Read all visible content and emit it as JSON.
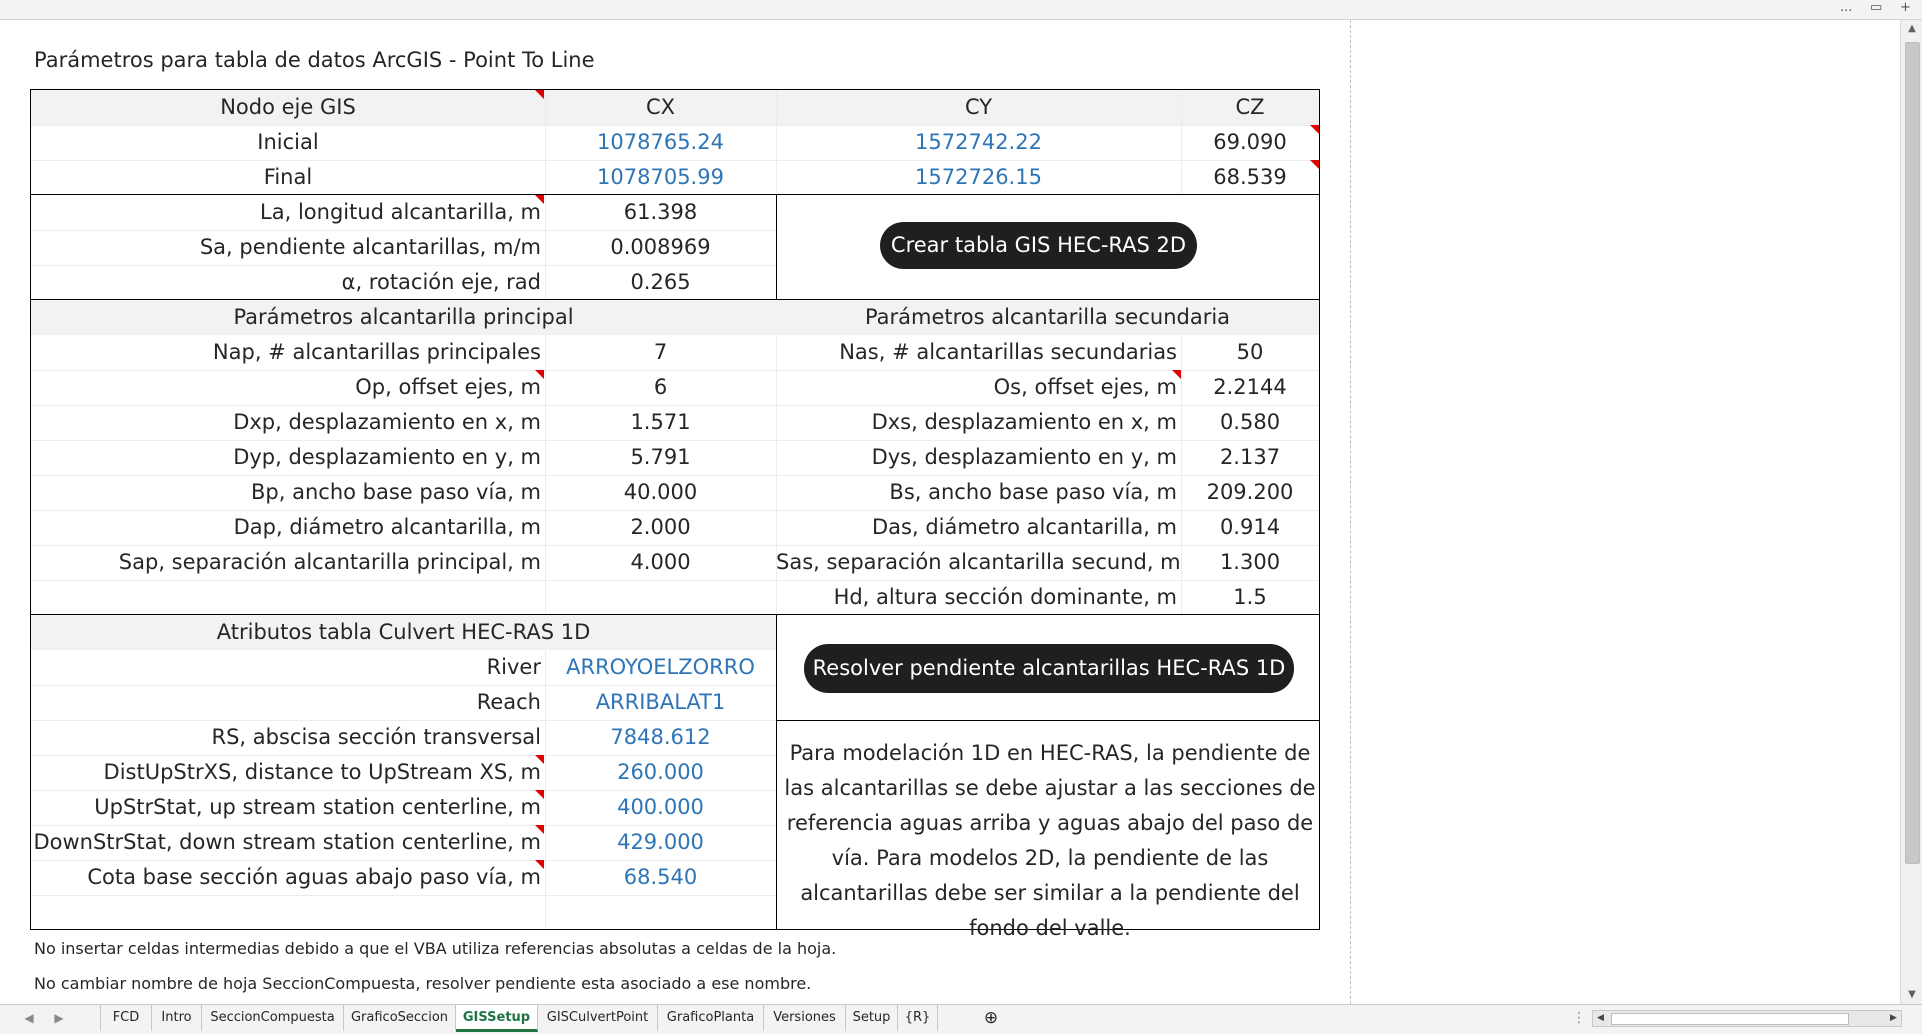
{
  "window": {
    "controls": [
      "...",
      "▭",
      "+"
    ]
  },
  "title": "Parámetros para tabla de datos ArcGIS - Point To Line",
  "nodes": {
    "headers": [
      "Nodo eje GIS",
      "CX",
      "CY",
      "CZ"
    ],
    "rows": [
      {
        "name": "Inicial",
        "cx": "1078765.24",
        "cy": "1572742.22",
        "cz": "69.090"
      },
      {
        "name": "Final",
        "cx": "1078705.99",
        "cy": "1572726.15",
        "cz": "68.539"
      }
    ]
  },
  "geometry": [
    {
      "label": "La, longitud alcantarilla, m",
      "value": "61.398"
    },
    {
      "label": "Sa, pendiente alcantarillas, m/m",
      "value": "0.008969"
    },
    {
      "label": "α, rotación eje, rad",
      "value": "0.265"
    }
  ],
  "buttons": {
    "create_gis": "Crear tabla GIS HEC-RAS 2D",
    "solve_slope": "Resolver pendiente alcantarillas HEC-RAS 1D"
  },
  "principal": {
    "header": "Parámetros alcantarilla principal",
    "rows": [
      {
        "label": "Nap, # alcantarillas principales",
        "value": "7"
      },
      {
        "label": "Op, offset ejes, m",
        "value": "6"
      },
      {
        "label": "Dxp, desplazamiento en x, m",
        "value": "1.571"
      },
      {
        "label": "Dyp, desplazamiento en y, m",
        "value": "5.791"
      },
      {
        "label": "Bp, ancho base paso vía, m",
        "value": "40.000"
      },
      {
        "label": "Dap, diámetro alcantarilla, m",
        "value": "2.000"
      },
      {
        "label": "Sap, separación alcantarilla principal, m",
        "value": "4.000"
      }
    ]
  },
  "secundaria": {
    "header": "Parámetros alcantarilla secundaria",
    "rows": [
      {
        "label": "Nas, # alcantarillas secundarias",
        "value": "50"
      },
      {
        "label": "Os, offset ejes, m",
        "value": "2.2144"
      },
      {
        "label": "Dxs, desplazamiento en x, m",
        "value": "0.580"
      },
      {
        "label": "Dys, desplazamiento en y, m",
        "value": "2.137"
      },
      {
        "label": "Bs, ancho base paso vía, m",
        "value": "209.200"
      },
      {
        "label": "Das, diámetro alcantarilla, m",
        "value": "0.914"
      },
      {
        "label": "Sas, separación alcantarilla secund, m",
        "value": "1.300"
      },
      {
        "label": "Hd, altura sección dominante, m",
        "value": "1.5"
      }
    ]
  },
  "culvert": {
    "header": "Atributos tabla Culvert HEC-RAS 1D",
    "rows": [
      {
        "label": "River",
        "value": "ARROYOELZORRO"
      },
      {
        "label": "Reach",
        "value": "ARRIBALAT1"
      },
      {
        "label": "RS, abscisa sección transversal",
        "value": "7848.612"
      },
      {
        "label": "DistUpStrXS, distance to UpStream XS, m",
        "value": "260.000"
      },
      {
        "label": "UpStrStat, up stream station centerline, m",
        "value": "400.000"
      },
      {
        "label": "DownStrStat, down stream station centerline, m",
        "value": "429.000"
      },
      {
        "label": "Cota base sección aguas abajo paso vía, m",
        "value": "68.540"
      }
    ]
  },
  "explanation": "Para modelación 1D en HEC-RAS, la pendiente de las alcantarillas se debe ajustar a las secciones de referencia aguas arriba y aguas abajo del paso de vía. Para modelos 2D, la pendiente de las alcantarillas debe ser similar a la pendiente del fondo del valle.",
  "notes": [
    "No insertar celdas intermedias debido a que el VBA utiliza referencias absolutas a celdas de la hoja.",
    "No cambiar nombre de hoja SeccionCompuesta, resolver pendiente esta asociado a ese nombre."
  ],
  "tabs": {
    "items": [
      "FCD",
      "Intro",
      "SeccionCompuesta",
      "GraficoSeccion",
      "GISSetup",
      "GISCulvertPoint",
      "GraficoPlanta",
      "Versiones",
      "Setup",
      "{R}"
    ],
    "active": "GISSetup",
    "add": "⊕"
  },
  "colors": {
    "link_blue": "#2e75b6",
    "excel_green": "#217346",
    "comment_marker": "#e00000",
    "button_bg": "#1f1f1f"
  }
}
